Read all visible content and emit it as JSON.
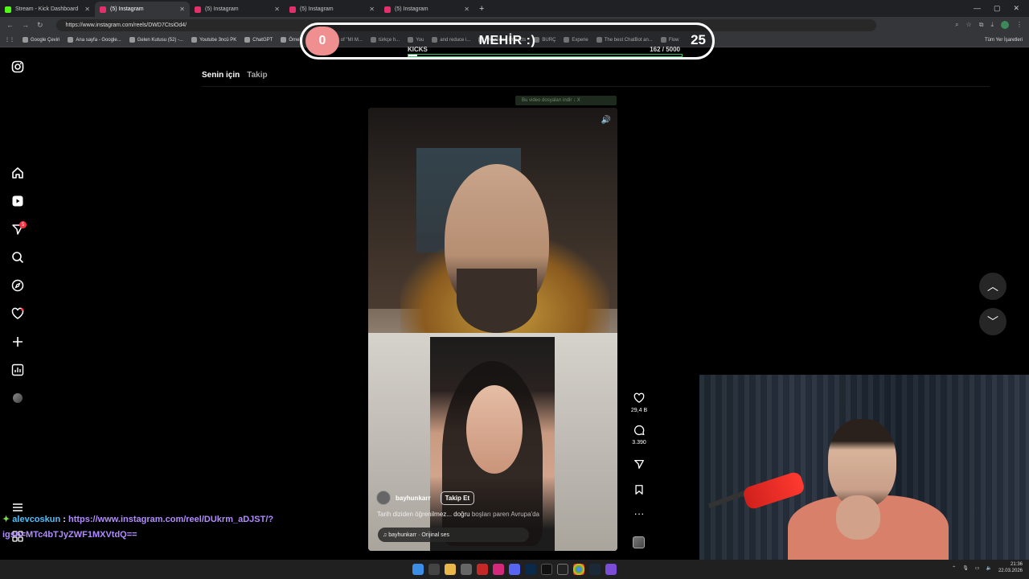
{
  "browser": {
    "tabs": [
      {
        "label": "Stream - Kick Dashboard",
        "color": "#53fc18",
        "active": false
      },
      {
        "label": "(5) Instagram",
        "color": "#e1306c",
        "active": true
      },
      {
        "label": "(5) Instagram",
        "color": "#e1306c",
        "active": false
      },
      {
        "label": "(5) Instagram",
        "color": "#e1306c",
        "active": false
      },
      {
        "label": "(5) Instagram",
        "color": "#e1306c",
        "active": false
      }
    ],
    "new_tab": "+",
    "url": "https://www.instagram.com/reels/DWD7CtsiOd4/",
    "bookmarks": [
      "Google Çeviri",
      "Ana sayfa - Google...",
      "Gelen Kutusu (52) -...",
      "Youtube 3ncü PK",
      "ChatGPT",
      "Örnek",
      "Transcript of \"MI M...",
      "türkçe h...",
      "You",
      "and reduce i...",
      "HeyGen - Projects",
      "BURÇ",
      "Experie",
      "The best ChatBot an...",
      "Flow"
    ],
    "all_bookmarks": "Tüm Yer İşaretleri"
  },
  "kicks_overlay": {
    "left_count": "0",
    "name": "MEHİR :)",
    "right_count": "25",
    "label": "KICKS",
    "progress_text": "162  / 5000",
    "progress": 0.0324
  },
  "instagram": {
    "feed_tabs": {
      "for_you": "Senin için",
      "following": "Takip"
    },
    "notification_badge": "5",
    "hint_text": "Bu video dosyaları indir  ↓ X",
    "reel": {
      "author": "bayhunkarr",
      "follow_label": "Takip Et",
      "caption": "Tarih diziden öğrenilmez... doğru",
      "caption_overlay": "boşları paren Avrupa'da",
      "audio": "♫ bayhunkarr · Orijinal ses",
      "likes": "29,4 B",
      "comments": "3.390"
    }
  },
  "chat": {
    "user": "alevcoskun",
    "separator": ":",
    "message": "https://www.instagram.com/reel/DUkrm_aDJST/?igsh=MTc4bTJyZWF1MXVtdQ=="
  },
  "taskbar": {
    "time": "21:36",
    "date": "22.03.2026"
  }
}
